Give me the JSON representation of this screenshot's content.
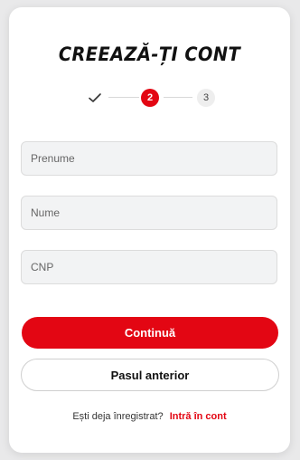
{
  "page": {
    "title": "CREEAZĂ-ȚI CONT"
  },
  "stepper": {
    "step1_icon": "checkmark-icon",
    "step2_label": "2",
    "step3_label": "3",
    "active_color": "#e30613"
  },
  "form": {
    "prenume_placeholder": "Prenume",
    "nume_placeholder": "Nume",
    "cnp_placeholder": "CNP",
    "prenume_value": "",
    "nume_value": "",
    "cnp_value": ""
  },
  "buttons": {
    "continue_label": "Continuă",
    "previous_label": "Pasul anterior"
  },
  "footer": {
    "question": "Ești deja înregistrat?",
    "login_link": "Intră în cont"
  },
  "colors": {
    "brand": "#e30613"
  }
}
